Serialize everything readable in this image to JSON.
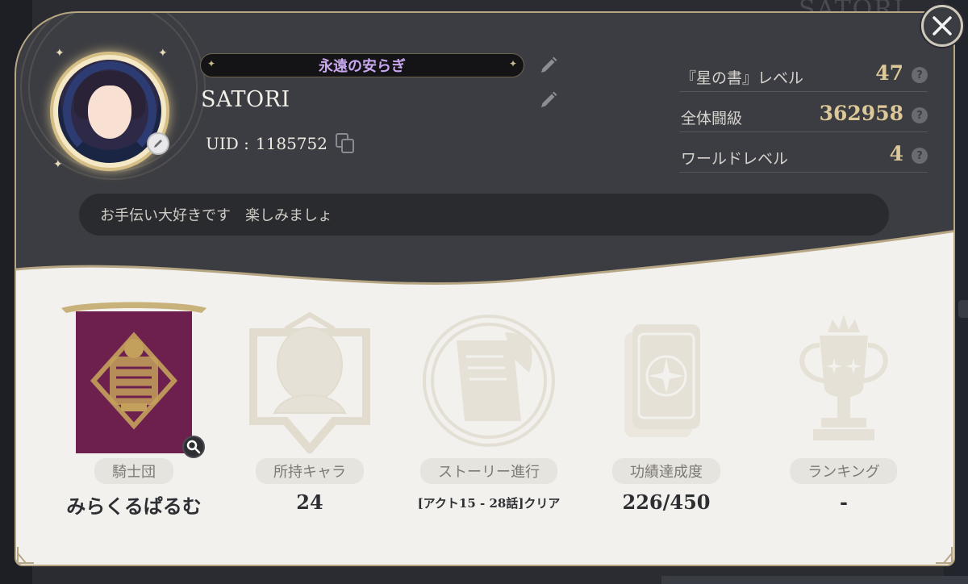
{
  "background": {
    "title_text": "SATORI"
  },
  "profile": {
    "title_badge": "永遠の安らぎ",
    "player_name": "SATORI",
    "uid_label": "UID :",
    "uid_value": "1185752",
    "comment": "お手伝い大好きです　楽しみましょ"
  },
  "stats": [
    {
      "label": "『星の書』レベル",
      "value": "47",
      "help": "?"
    },
    {
      "label": "全体闘級",
      "value": "362958",
      "help": "?"
    },
    {
      "label": "ワールドレベル",
      "value": "4",
      "help": "?"
    }
  ],
  "achievements": [
    {
      "label": "騎士団",
      "value": "みらくるぱるむ",
      "icon": "knights-banner-icon"
    },
    {
      "label": "所持キャラ",
      "value": "24",
      "icon": "character-icon"
    },
    {
      "label": "ストーリー進行",
      "value": "[アクト15 - 28話]クリア",
      "icon": "story-scroll-icon"
    },
    {
      "label": "功績達成度",
      "value": "226/450",
      "icon": "achievement-card-icon"
    },
    {
      "label": "ランキング",
      "value": "-",
      "icon": "trophy-icon"
    }
  ],
  "colors": {
    "panel_dark": "#3c3d42",
    "panel_light": "#f2f1ee",
    "gold": "#dcc898",
    "title_purple": "#c9a7ef",
    "banner_purple": "#6d1f4e"
  },
  "icons": {
    "close": "close-icon",
    "edit": "pencil-icon",
    "copy": "copy-icon",
    "help": "question-icon",
    "zoom": "magnifier-icon"
  }
}
